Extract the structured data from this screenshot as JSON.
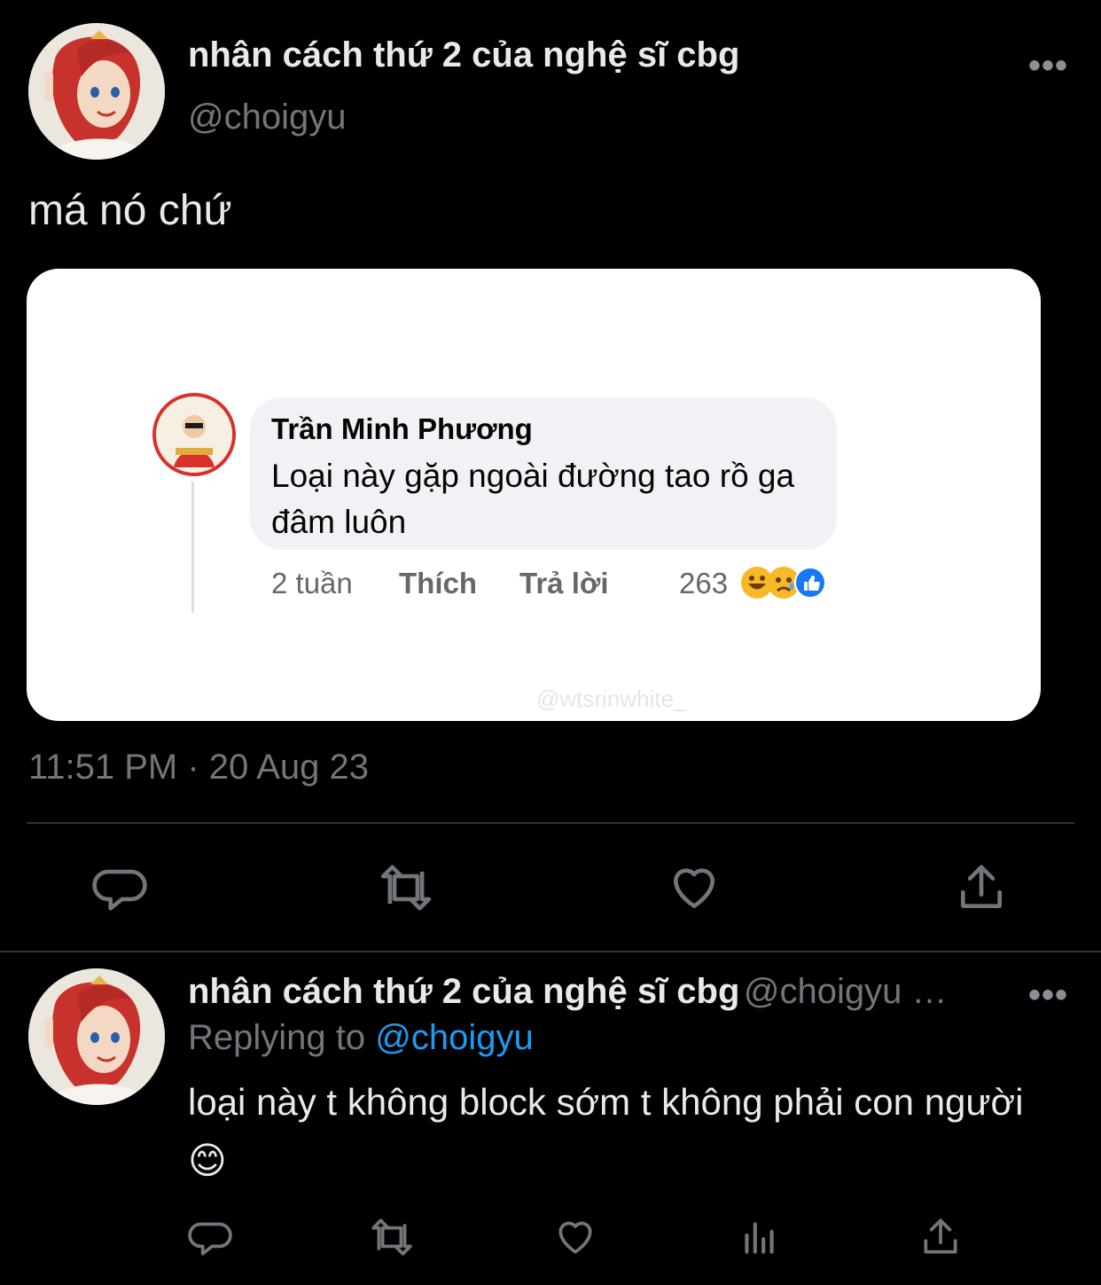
{
  "tweet": {
    "display_name": "nhân cách thứ 2 của nghệ sĩ cbg",
    "handle": "@choigyu",
    "more": "•••",
    "text": "má nó chứ",
    "timestamp": "11:51 PM · 20 Aug 23",
    "actions": {
      "reply_icon": "reply-icon",
      "retweet_icon": "retweet-icon",
      "like_icon": "heart-icon",
      "share_icon": "share-icon"
    }
  },
  "embedded_comment": {
    "author": "Trần Minh Phương",
    "text": "Loại này gặp ngoài đường tao rồ ga đâm luôn",
    "age": "2 tuần",
    "like_label": "Thích",
    "reply_label": "Trả lời",
    "reaction_count": "263",
    "watermark": "@wtsrinwhite_"
  },
  "reply": {
    "display_name": "nhân cách thứ 2 của nghệ sĩ cbg",
    "handle": "@choigyu …",
    "more": "•••",
    "replying_prefix": "Replying to",
    "replying_handle": "@choigyu",
    "text": "loại này t không block sớm t không phải con người 😊"
  },
  "colors": {
    "background": "#000000",
    "text": "#e7e9ea",
    "muted": "#71767b",
    "link": "#1d9bf0",
    "divider": "#2f3336"
  }
}
